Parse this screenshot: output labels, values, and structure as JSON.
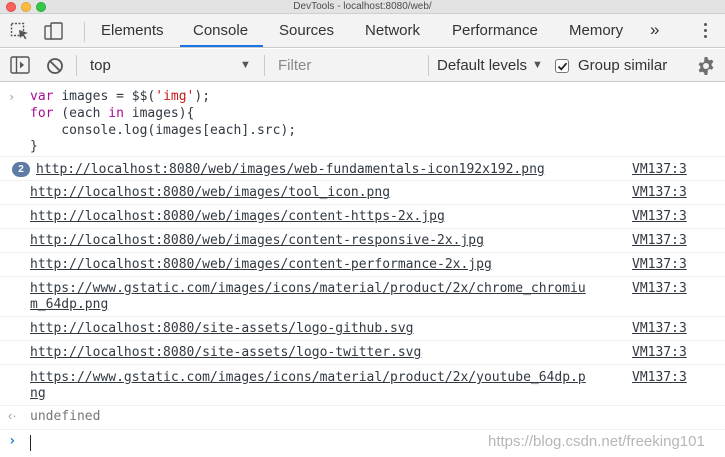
{
  "window": {
    "title": "DevTools - localhost:8080/web/"
  },
  "tabs": [
    "Elements",
    "Console",
    "Sources",
    "Network",
    "Performance",
    "Memory"
  ],
  "tabs_overflow": "»",
  "active_tab": "Console",
  "toolbar": {
    "context": "top",
    "filter_placeholder": "Filter",
    "levels": "Default levels",
    "group_similar": "Group similar",
    "group_similar_checked": true
  },
  "console": {
    "input_code": [
      [
        "var ",
        "images",
        " = $$(",
        "'img'",
        ");"
      ],
      [
        "for",
        " (each ",
        "in",
        " images){"
      ],
      [
        "    console.log(images[each].src);"
      ],
      [
        "}"
      ]
    ],
    "messages": [
      {
        "url": "http://localhost:8080/web/images/web-fundamentals-icon192x192.png",
        "source": "VM137:3",
        "count": "2"
      },
      {
        "url": "http://localhost:8080/web/images/tool_icon.png",
        "source": "VM137:3"
      },
      {
        "url": "http://localhost:8080/web/images/content-https-2x.jpg",
        "source": "VM137:3"
      },
      {
        "url": "http://localhost:8080/web/images/content-responsive-2x.jpg",
        "source": "VM137:3"
      },
      {
        "url": "http://localhost:8080/web/images/content-performance-2x.jpg",
        "source": "VM137:3"
      },
      {
        "url_line1": "https://www.gstatic.com/images/icons/material/product/2x/chrome_chromiu",
        "url_line2": "m_64dp.png",
        "source": "VM137:3"
      },
      {
        "url": "http://localhost:8080/site-assets/logo-github.svg",
        "source": "VM137:3"
      },
      {
        "url": "http://localhost:8080/site-assets/logo-twitter.svg",
        "source": "VM137:3"
      },
      {
        "url_line1": "https://www.gstatic.com/images/icons/material/product/2x/youtube_64dp.p",
        "url_line2": "ng",
        "source": "VM137:3"
      }
    ],
    "result": "undefined"
  },
  "watermark": "https://blog.csdn.net/freeking101",
  "colors": {
    "accent": "#1a73e8",
    "badge": "#5e7ba6",
    "keyword": "#aa0d91",
    "string": "#c41a16"
  }
}
